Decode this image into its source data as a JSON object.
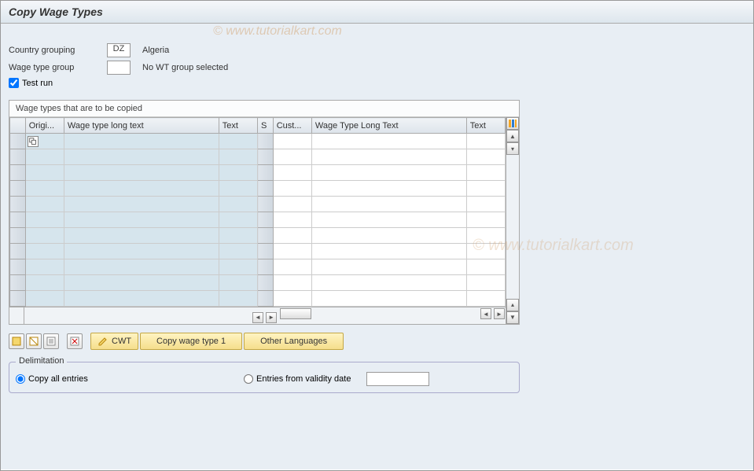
{
  "header": {
    "title": "Copy Wage Types"
  },
  "watermark": "© www.tutorialkart.com",
  "form": {
    "country_label": "Country grouping",
    "country_value": "DZ",
    "country_desc": "Algeria",
    "wtgroup_label": "Wage type group",
    "wtgroup_value": "",
    "wtgroup_desc": "No WT group selected",
    "testrun_label": "Test run",
    "testrun_checked": true
  },
  "table": {
    "title": "Wage types that are to be copied",
    "columns_left": [
      "Origi...",
      "Wage type long text",
      "Text"
    ],
    "columns_right": [
      "S",
      "Cust...",
      "Wage Type Long Text",
      "Text"
    ],
    "rows": 11
  },
  "toolbar": {
    "cwt_label": "CWT",
    "copy1_label": "Copy wage type 1",
    "otherlang_label": "Other Languages"
  },
  "delimitation": {
    "title": "Delimitation",
    "opt_all": "Copy all entries",
    "opt_from": "Entries from validity date",
    "selected": "all",
    "date": ""
  }
}
